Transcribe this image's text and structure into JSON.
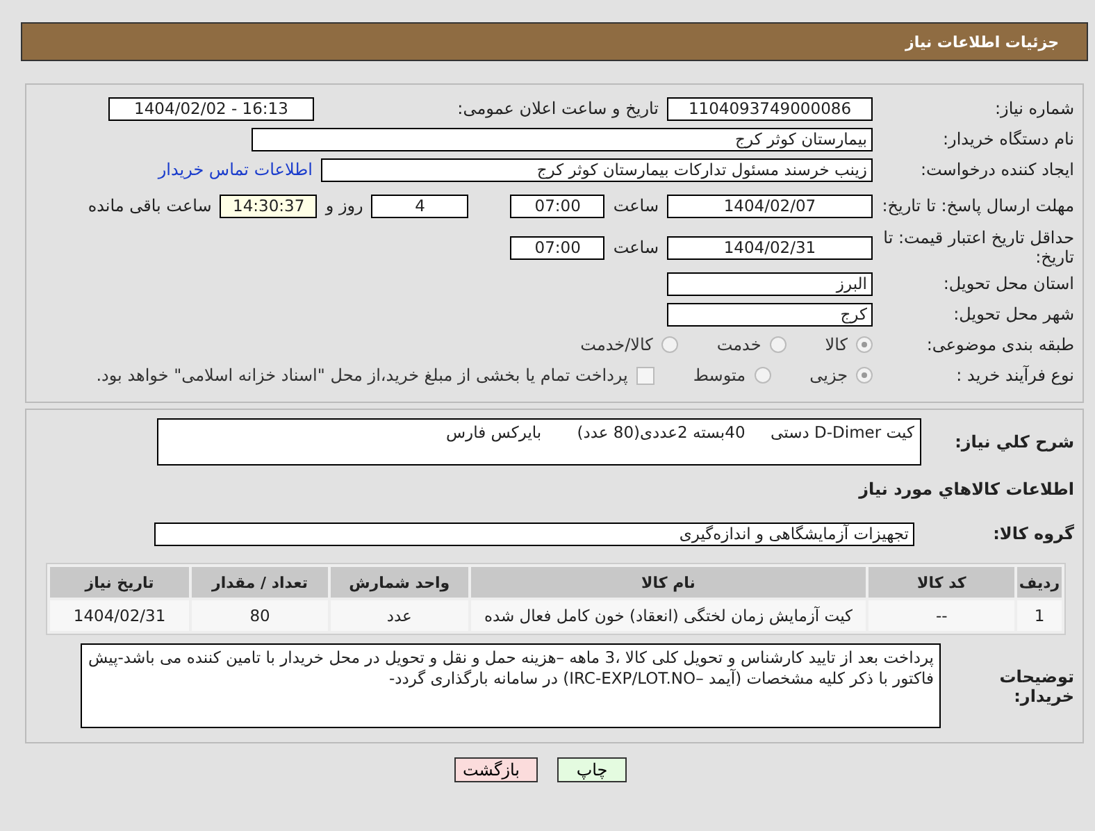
{
  "header": {
    "title": "جزئیات اطلاعات نیاز"
  },
  "need_number": {
    "label": "شماره نیاز:",
    "value": "1104093749000086"
  },
  "announce": {
    "label": "تاریخ و ساعت اعلان عمومی:",
    "value": "1404/02/02 - 16:13"
  },
  "buyer": {
    "label": "نام دستگاه خریدار:",
    "value": "بیمارستان کوثر کرج"
  },
  "creator": {
    "label": "ایجاد کننده درخواست:",
    "value": "زینب خرسند مسئول تدارکات بیمارستان کوثر کرج",
    "link": "اطلاعات تماس خریدار"
  },
  "deadline": {
    "label": "مهلت ارسال پاسخ: تا تاریخ:",
    "date": "1404/02/07",
    "time_label": "ساعت",
    "time": "07:00",
    "days": "4",
    "days_label": "روز و",
    "remaining": "14:30:37",
    "remaining_label": "ساعت باقی مانده"
  },
  "validity": {
    "label": "حداقل تاریخ اعتبار قیمت: تا تاریخ:",
    "date": "1404/02/31",
    "time_label": "ساعت",
    "time": "07:00"
  },
  "province": {
    "label": "استان محل تحویل:",
    "value": "البرز"
  },
  "city": {
    "label": "شهر محل تحویل:",
    "value": "کرج"
  },
  "category": {
    "label": "طبقه بندی موضوعی:",
    "options": [
      {
        "label": "کالا",
        "selected": true
      },
      {
        "label": "خدمت",
        "selected": false
      },
      {
        "label": "کالا/خدمت",
        "selected": false
      }
    ]
  },
  "process": {
    "label": "نوع فرآیند خرید :",
    "options": [
      {
        "label": "جزیی",
        "selected": true
      },
      {
        "label": "متوسط",
        "selected": false
      }
    ],
    "treasury": {
      "checked": false,
      "label": "پرداخت تمام یا بخشی از مبلغ خرید،از محل \"اسناد خزانه اسلامی\" خواهد بود."
    }
  },
  "summary": {
    "label": "شرح کلي نياز:",
    "value": "کیت D-Dimer دستی     40بسته 2عددی(80 عدد)       بایرکس فارس"
  },
  "goods_heading": "اطلاعات کالاهاي مورد نياز",
  "goods_group": {
    "label": "گروه کالا:",
    "value": "تجهیزات آزمایشگاهی و اندازه‌گیری"
  },
  "table": {
    "columns": [
      "ردیف",
      "کد کالا",
      "نام کالا",
      "واحد شمارش",
      "تعداد / مقدار",
      "تاریخ نیاز"
    ],
    "rows": [
      [
        "1",
        "--",
        "کیت آزمایش زمان لختگی (انعقاد) خون کامل فعال شده",
        "عدد",
        "80",
        "1404/02/31"
      ]
    ]
  },
  "notes": {
    "label": "توضیحات خریدار:",
    "value": "پرداخت بعد از تایید کارشناس و تحویل کلی کالا ،3 ماهه –هزینه حمل و نقل و تحویل در محل خریدار با تامین کننده می باشد-پیش فاکتور با ذکر کلیه مشخصات (آیمد –IRC-EXP/LOT.NO) در سامانه بارگذاری گردد-"
  },
  "buttons": {
    "print": "چاپ",
    "back": "بازگشت"
  }
}
